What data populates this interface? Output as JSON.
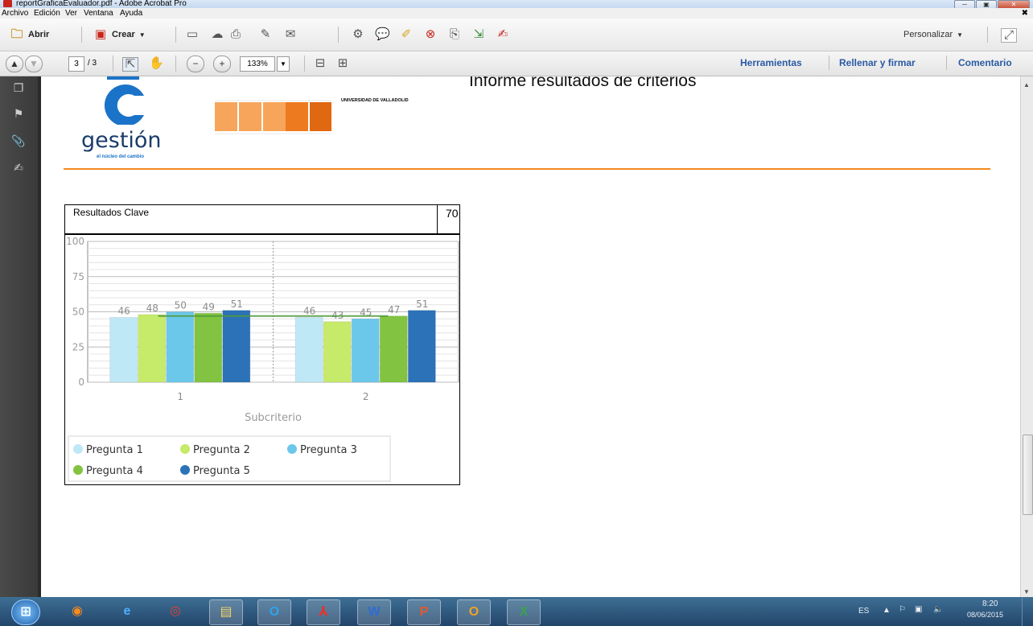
{
  "window": {
    "title": "reportGraficaEvaluador.pdf - Adobe Acrobat Pro",
    "min": "─",
    "max": "▣",
    "close": "✕"
  },
  "menu": [
    "Archivo",
    "Edición",
    "Ver",
    "Ventana",
    "Ayuda"
  ],
  "toolbar": {
    "open_label": "Abrir",
    "create_label": "Crear",
    "customize_label": "Personalizar"
  },
  "nav": {
    "page_current": "3",
    "page_total": "/ 3",
    "zoom": "133%"
  },
  "right_panel_links": {
    "tools": "Herramientas",
    "fill_sign": "Rellenar y firmar",
    "comment": "Comentario"
  },
  "document": {
    "report_title": "Informe resultados de criterios",
    "logo_word": "gestión",
    "logo_tagline": "el núcleo del cambio",
    "university": "UNIVERSIDAD DE VALLADOLID",
    "section_label": "Resultados Clave",
    "section_score": "70",
    "accent_color": "#f08a1c"
  },
  "chart_data": {
    "type": "bar",
    "categories": [
      "1",
      "2"
    ],
    "xlabel": "Subcriterio",
    "ylim": [
      0,
      100
    ],
    "yticks": [
      "0",
      "25",
      "50",
      "75",
      "100"
    ],
    "reference_line": 47,
    "legend_position": "bottom",
    "series": [
      {
        "name": "Pregunta 1",
        "values": [
          46,
          46
        ],
        "color": "#bfe8f6",
        "labels": [
          "46",
          "46"
        ]
      },
      {
        "name": "Pregunta 2",
        "values": [
          48,
          43
        ],
        "color": "#c6ea6a",
        "labels": [
          "48",
          "43"
        ]
      },
      {
        "name": "Pregunta 3",
        "values": [
          50,
          45
        ],
        "color": "#6cc8ea",
        "labels": [
          "50",
          "45"
        ]
      },
      {
        "name": "Pregunta 4",
        "values": [
          49,
          47
        ],
        "color": "#82c441",
        "labels": [
          "49",
          "47"
        ]
      },
      {
        "name": "Pregunta 5",
        "values": [
          51,
          51
        ],
        "color": "#2c72b8",
        "labels": [
          "51",
          "51"
        ]
      }
    ]
  },
  "taskbar": {
    "lang": "ES",
    "time": "8:20",
    "date": "08/06/2015"
  }
}
